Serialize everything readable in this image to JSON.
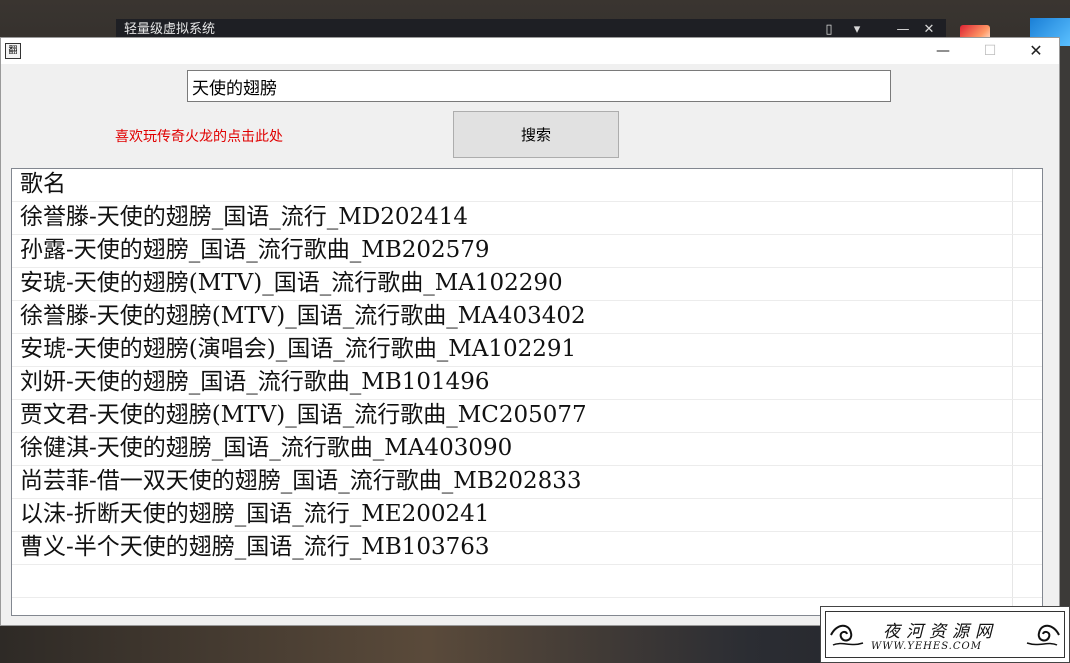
{
  "background_window": {
    "title": "轻量级虚拟系统"
  },
  "window": {
    "icon_glyph": "翻",
    "controls": {
      "minimize": "—",
      "maximize": "☐",
      "close": "✕"
    }
  },
  "search": {
    "value": "天使的翅膀",
    "button_label": "搜索"
  },
  "promo_link": "喜欢玩传奇火龙的点击此处",
  "results": {
    "header": "歌名",
    "items": [
      "徐誉滕-天使的翅膀_国语_流行_MD202414",
      "孙露-天使的翅膀_国语_流行歌曲_MB202579",
      "安琥-天使的翅膀(MTV)_国语_流行歌曲_MA102290",
      "徐誉滕-天使的翅膀(MTV)_国语_流行歌曲_MA403402",
      "安琥-天使的翅膀(演唱会)_国语_流行歌曲_MA102291",
      "刘妍-天使的翅膀_国语_流行歌曲_MB101496",
      "贾文君-天使的翅膀(MTV)_国语_流行歌曲_MC205077",
      "徐健淇-天使的翅膀_国语_流行歌曲_MA403090",
      "尚芸菲-借一双天使的翅膀_国语_流行歌曲_MB202833",
      "以沫-折断天使的翅膀_国语_流行_ME200241",
      "曹义-半个天使的翅膀_国语_流行_MB103763"
    ]
  },
  "watermark": {
    "title": "夜河资源网",
    "url": "WWW.YEHES.COM"
  },
  "colors": {
    "promo": "#e00000",
    "window_bg": "#f0f0f0"
  }
}
